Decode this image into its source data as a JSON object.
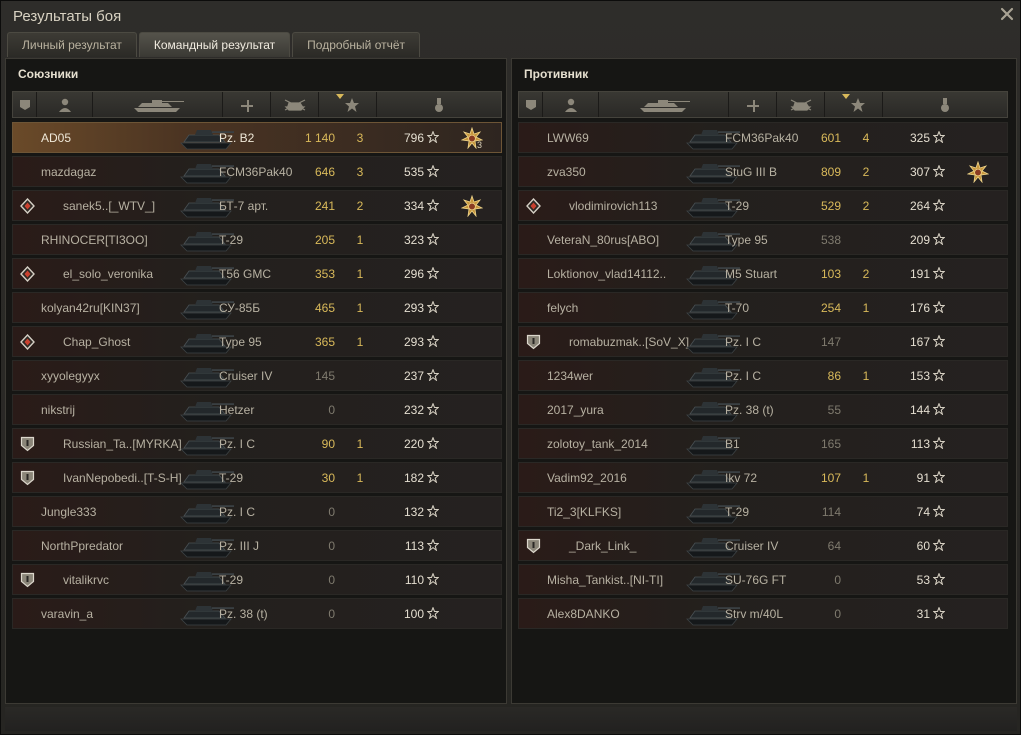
{
  "window": {
    "title": "Результаты боя",
    "close_icon": "close-icon"
  },
  "tabs": [
    {
      "label": "Личный результат",
      "active": false
    },
    {
      "label": "Командный результат",
      "active": true
    },
    {
      "label": "Подробный отчёт",
      "active": false
    }
  ],
  "columns": [
    "platoon-icon",
    "player-icon",
    "tank-icon",
    "damage-icon",
    "kills-icon",
    "xp-star-icon",
    "medal-icon"
  ],
  "allies": {
    "title": "Союзники",
    "rows": [
      {
        "badge": "",
        "name": "AD05",
        "tank": "Pz. B2",
        "damage": "1 140",
        "kills": "3",
        "xp": "796",
        "medal": "medal",
        "medal_count": "3",
        "me": true
      },
      {
        "badge": "",
        "name": "mazdagaz",
        "tank": "FCM36Pak40",
        "damage": "646",
        "kills": "3",
        "xp": "535",
        "medal": "",
        "medal_count": ""
      },
      {
        "badge": "diamond",
        "name": "sanek5..[_WTV_]",
        "tank": "БТ-7 арт.",
        "damage": "241",
        "kills": "2",
        "xp": "334",
        "medal": "medal",
        "medal_count": ""
      },
      {
        "badge": "",
        "name": "RHINOCER[TI3OO]",
        "tank": "T-29",
        "damage": "205",
        "kills": "1",
        "xp": "323",
        "medal": "",
        "medal_count": ""
      },
      {
        "badge": "diamond",
        "name": "el_solo_veronika",
        "tank": "T56 GMC",
        "damage": "353",
        "kills": "1",
        "xp": "296",
        "medal": "",
        "medal_count": ""
      },
      {
        "badge": "",
        "name": "kolyan42ru[KIN37]",
        "tank": "СУ-85Б",
        "damage": "465",
        "kills": "1",
        "xp": "293",
        "medal": "",
        "medal_count": ""
      },
      {
        "badge": "diamond",
        "name": "Chap_Ghost",
        "tank": "Type 95",
        "damage": "365",
        "kills": "1",
        "xp": "293",
        "medal": "",
        "medal_count": ""
      },
      {
        "badge": "",
        "name": "xyyolegyyx",
        "tank": "Cruiser IV",
        "damage": "145",
        "kills": "",
        "xp": "237",
        "medal": "",
        "medal_count": ""
      },
      {
        "badge": "",
        "name": "nikstrij",
        "tank": "Hetzer",
        "damage": "0",
        "kills": "",
        "xp": "232",
        "medal": "",
        "medal_count": ""
      },
      {
        "badge": "shield",
        "name": "Russian_Ta..[MYRKA]",
        "tank": "Pz. I C",
        "damage": "90",
        "kills": "1",
        "xp": "220",
        "medal": "",
        "medal_count": ""
      },
      {
        "badge": "shield",
        "name": "IvanNepobedi..[T-S-H]",
        "tank": "T-29",
        "damage": "30",
        "kills": "1",
        "xp": "182",
        "medal": "",
        "medal_count": ""
      },
      {
        "badge": "",
        "name": "Jungle333",
        "tank": "Pz. I C",
        "damage": "0",
        "kills": "",
        "xp": "132",
        "medal": "",
        "medal_count": ""
      },
      {
        "badge": "",
        "name": "NorthPpredator",
        "tank": "Pz. III J",
        "damage": "0",
        "kills": "",
        "xp": "113",
        "medal": "",
        "medal_count": ""
      },
      {
        "badge": "shield",
        "name": "vitalikrvc",
        "tank": "T-29",
        "damage": "0",
        "kills": "",
        "xp": "110",
        "medal": "",
        "medal_count": ""
      },
      {
        "badge": "",
        "name": "varavin_a",
        "tank": "Pz. 38 (t)",
        "damage": "0",
        "kills": "",
        "xp": "100",
        "medal": "",
        "medal_count": ""
      }
    ]
  },
  "enemies": {
    "title": "Противник",
    "rows": [
      {
        "badge": "",
        "name": "LWW69",
        "tank": "FCM36Pak40",
        "damage": "601",
        "kills": "4",
        "xp": "325",
        "medal": "",
        "medal_count": ""
      },
      {
        "badge": "",
        "name": "zva350",
        "tank": "StuG III B",
        "damage": "809",
        "kills": "2",
        "xp": "307",
        "medal": "medal",
        "medal_count": ""
      },
      {
        "badge": "diamond",
        "name": "vlodimirovich113",
        "tank": "T-29",
        "damage": "529",
        "kills": "2",
        "xp": "264",
        "medal": "",
        "medal_count": ""
      },
      {
        "badge": "",
        "name": "VeteraN_80rus[ABO]",
        "tank": "Type 95",
        "damage": "538",
        "kills": "",
        "xp": "209",
        "medal": "",
        "medal_count": ""
      },
      {
        "badge": "",
        "name": "Loktionov_vlad14112..",
        "tank": "M5 Stuart",
        "damage": "103",
        "kills": "2",
        "xp": "191",
        "medal": "",
        "medal_count": ""
      },
      {
        "badge": "",
        "name": "felych",
        "tank": "T-70",
        "damage": "254",
        "kills": "1",
        "xp": "176",
        "medal": "",
        "medal_count": ""
      },
      {
        "badge": "shield",
        "name": "romabuzmak..[SoV_X]",
        "tank": "Pz. I C",
        "damage": "147",
        "kills": "",
        "xp": "167",
        "medal": "",
        "medal_count": ""
      },
      {
        "badge": "",
        "name": "1234wer",
        "tank": "Pz. I C",
        "damage": "86",
        "kills": "1",
        "xp": "153",
        "medal": "",
        "medal_count": ""
      },
      {
        "badge": "",
        "name": "2017_yura",
        "tank": "Pz. 38 (t)",
        "damage": "55",
        "kills": "",
        "xp": "144",
        "medal": "",
        "medal_count": ""
      },
      {
        "badge": "",
        "name": "zolotoy_tank_2014",
        "tank": "B1",
        "damage": "165",
        "kills": "",
        "xp": "113",
        "medal": "",
        "medal_count": ""
      },
      {
        "badge": "",
        "name": "Vadim92_2016",
        "tank": "Ikv 72",
        "damage": "107",
        "kills": "1",
        "xp": "91",
        "medal": "",
        "medal_count": ""
      },
      {
        "badge": "",
        "name": "Ti2_3[KLFKS]",
        "tank": "T-29",
        "damage": "114",
        "kills": "",
        "xp": "74",
        "medal": "",
        "medal_count": ""
      },
      {
        "badge": "shield",
        "name": "_Dark_Link_",
        "tank": "Cruiser IV",
        "damage": "64",
        "kills": "",
        "xp": "60",
        "medal": "",
        "medal_count": ""
      },
      {
        "badge": "",
        "name": "Misha_Tankist..[NI-TI]",
        "tank": "SU-76G FT",
        "damage": "0",
        "kills": "",
        "xp": "53",
        "medal": "",
        "medal_count": ""
      },
      {
        "badge": "",
        "name": "Alex8DANKO",
        "tank": "Strv m/40L",
        "damage": "0",
        "kills": "",
        "xp": "31",
        "medal": "",
        "medal_count": ""
      }
    ]
  },
  "colors": {
    "accent_gold": "#d9b95a",
    "my_row": "#6a4a29"
  }
}
